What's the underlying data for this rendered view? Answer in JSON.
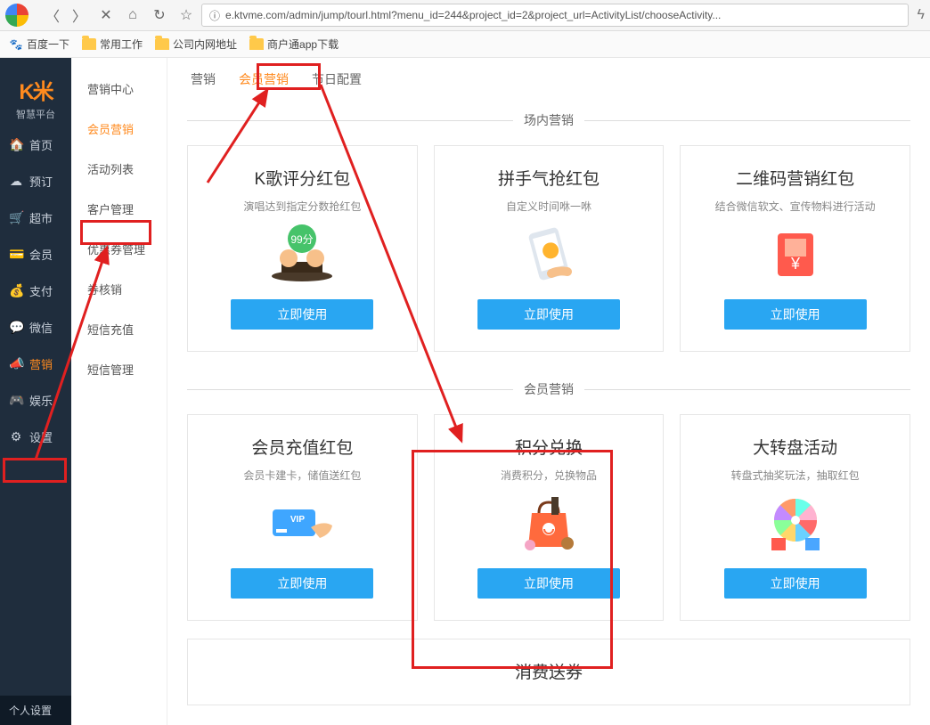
{
  "browser": {
    "url": "e.ktvme.com/admin/jump/tourl.html?menu_id=244&project_id=2&project_url=ActivityList/chooseActivity...",
    "security_icon": "ⓘ"
  },
  "bookmarks": [
    {
      "label": "百度一下",
      "type": "paw"
    },
    {
      "label": "常用工作",
      "type": "folder"
    },
    {
      "label": "公司内网地址",
      "type": "folder"
    },
    {
      "label": "商户通app下载",
      "type": "folder"
    }
  ],
  "brand": {
    "logo": "K米",
    "sub": "智慧平台"
  },
  "sidebar_main": [
    {
      "icon": "🏠",
      "label": "首页"
    },
    {
      "icon": "☁",
      "label": "预订"
    },
    {
      "icon": "🛒",
      "label": "超市"
    },
    {
      "icon": "💳",
      "label": "会员"
    },
    {
      "icon": "💰",
      "label": "支付"
    },
    {
      "icon": "💬",
      "label": "微信"
    },
    {
      "icon": "📣",
      "label": "营销",
      "active": true
    },
    {
      "icon": "🎮",
      "label": "娱乐"
    },
    {
      "icon": "⚙",
      "label": "设置"
    }
  ],
  "sidebar_foot": "个人设置",
  "sidebar_sub": [
    {
      "label": "营销中心"
    },
    {
      "label": "会员营销",
      "active": true
    },
    {
      "label": "活动列表"
    },
    {
      "label": "客户管理"
    },
    {
      "label": "优惠券管理"
    },
    {
      "label": "券核销"
    },
    {
      "label": "短信充值"
    },
    {
      "label": "短信管理"
    }
  ],
  "tabs": [
    {
      "label": "营销"
    },
    {
      "label": "会员营销",
      "active": true
    },
    {
      "label": "节日配置"
    }
  ],
  "sections": [
    {
      "title": "场内营销",
      "cards": [
        {
          "title": "K歌评分红包",
          "desc": "演唱达到指定分数抢红包",
          "btn": "立即使用",
          "illus": "kscore"
        },
        {
          "title": "拼手气抢红包",
          "desc": "自定义时间咻一咻",
          "btn": "立即使用",
          "illus": "phone"
        },
        {
          "title": "二维码营销红包",
          "desc": "结合微信软文、宣传物料进行活动",
          "btn": "立即使用",
          "illus": "qr"
        }
      ]
    },
    {
      "title": "会员营销",
      "cards": [
        {
          "title": "会员充值红包",
          "desc": "会员卡建卡，储值送红包",
          "btn": "立即使用",
          "illus": "vip"
        },
        {
          "title": "积分兑换",
          "desc": "消费积分，兑换物品",
          "btn": "立即使用",
          "illus": "bag"
        },
        {
          "title": "大转盘活动",
          "desc": "转盘式抽奖玩法，抽取红包",
          "btn": "立即使用",
          "illus": "wheel"
        }
      ]
    },
    {
      "title": "",
      "cards": [
        {
          "title": "消费送券",
          "desc": "",
          "btn": "",
          "illus": ""
        }
      ]
    }
  ]
}
